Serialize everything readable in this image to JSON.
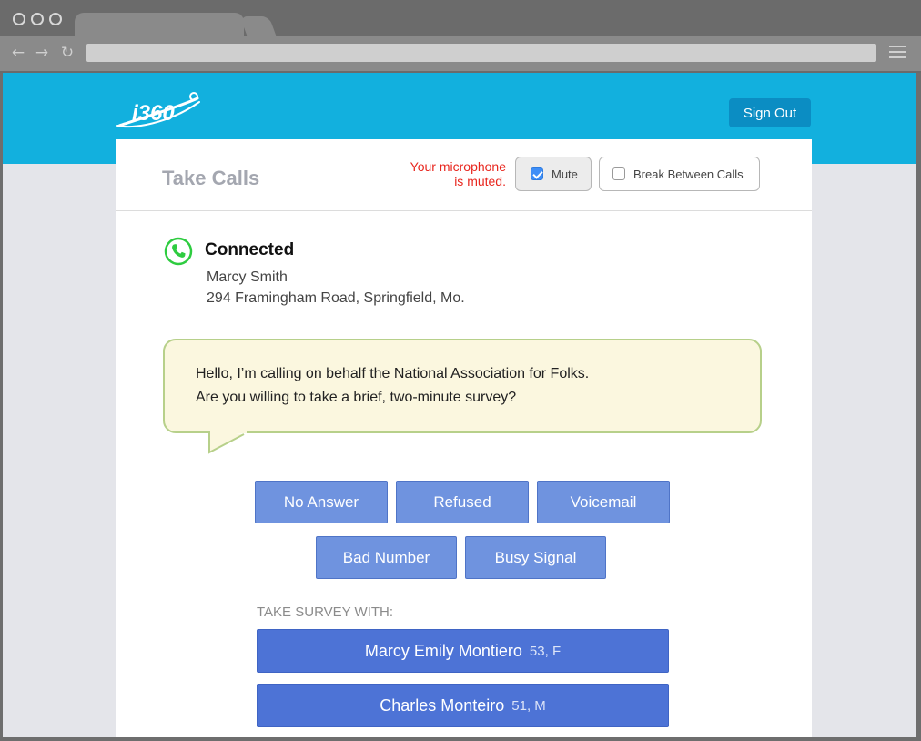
{
  "header": {
    "sign_out_label": "Sign Out"
  },
  "take_calls": {
    "title": "Take Calls",
    "mic_status_line1": "Your microphone",
    "mic_status_line2": "is muted.",
    "mute_label": "Mute",
    "mute_checked": true,
    "break_label": "Break Between Calls",
    "break_checked": false
  },
  "call": {
    "status": "Connected",
    "contact_name": "Marcy Smith",
    "contact_address": "294 Framingham Road, Springfield, Mo."
  },
  "script": {
    "line1": "Hello, I’m calling on behalf the National Association for Folks.",
    "line2": "Are you willing to take a brief, two-minute survey?"
  },
  "outcomes": [
    "No Answer",
    "Refused",
    "Voicemail",
    "Bad Number",
    "Busy Signal"
  ],
  "survey": {
    "label": "TAKE SURVEY WITH:",
    "respondents": [
      {
        "name": "Marcy Emily Montiero",
        "meta": "53, F"
      },
      {
        "name": "Charles Monteiro",
        "meta": "51, M"
      }
    ]
  },
  "colors": {
    "banner": "#12b0de",
    "button": "#6f93df",
    "respondent_button": "#4d73d6",
    "status_red": "#e8271f",
    "connected_green": "#2ecc40"
  },
  "icons": {
    "logo": "i360-logo",
    "phone": "phone-icon"
  }
}
